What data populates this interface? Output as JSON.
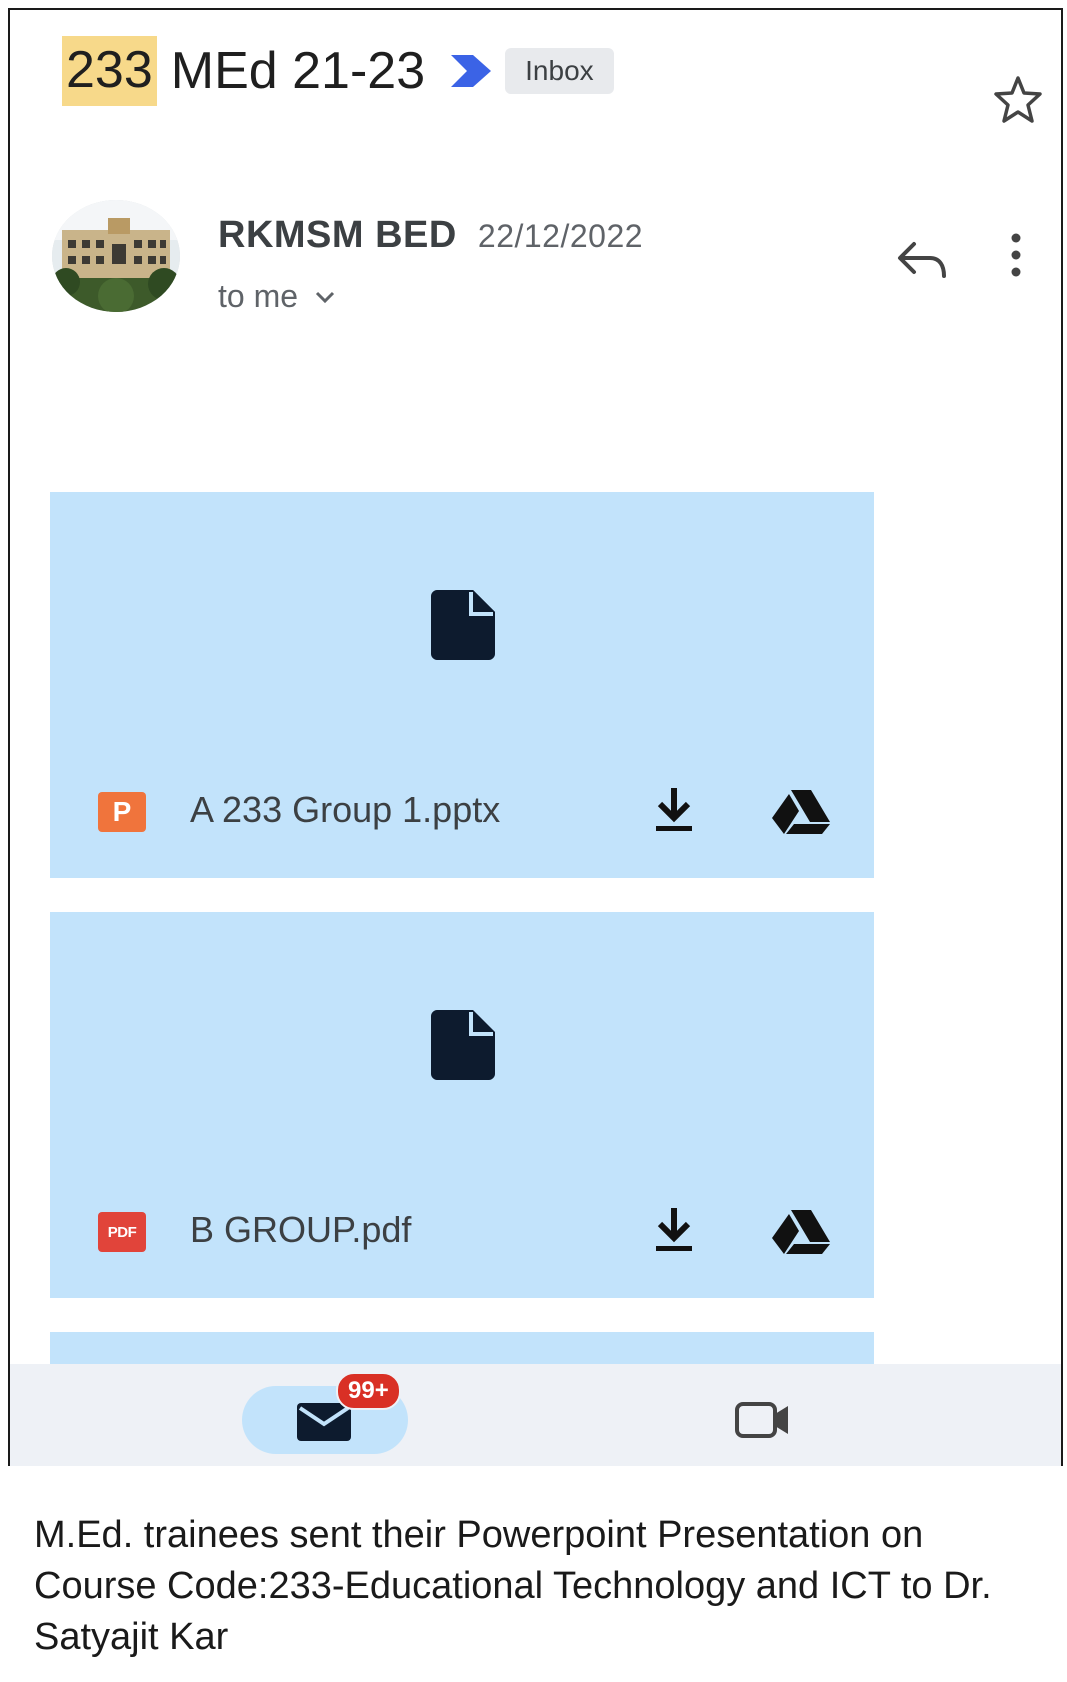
{
  "email": {
    "subject_highlight": "233",
    "subject_rest": "MEd 21-23",
    "label": "Inbox",
    "sender_name": "RKMSM BED",
    "date": "22/12/2022",
    "recipient": "to me"
  },
  "attachments": [
    {
      "name": "A 233 Group 1.pptx",
      "type_badge": "P",
      "type": "pptx"
    },
    {
      "name": "B GROUP.pdf",
      "type_badge": "PDF",
      "type": "pdf"
    }
  ],
  "bottom_nav": {
    "mail_badge": "99+"
  },
  "caption": "M.Ed. trainees sent their Powerpoint Presentation on Course Code:233-Educational Technology and ICT to Dr. Satyajit Kar",
  "colors": {
    "attachment_bg": "#c2e3fb",
    "highlight": "#f7d98a",
    "label_chevron": "#3b63e6",
    "badge": "#d93025"
  },
  "icons": [
    "label-chevron-icon",
    "star-icon",
    "reply-icon",
    "more-vert-icon",
    "chevron-down-icon",
    "file-icon",
    "download-icon",
    "drive-icon",
    "mail-icon",
    "video-icon"
  ]
}
